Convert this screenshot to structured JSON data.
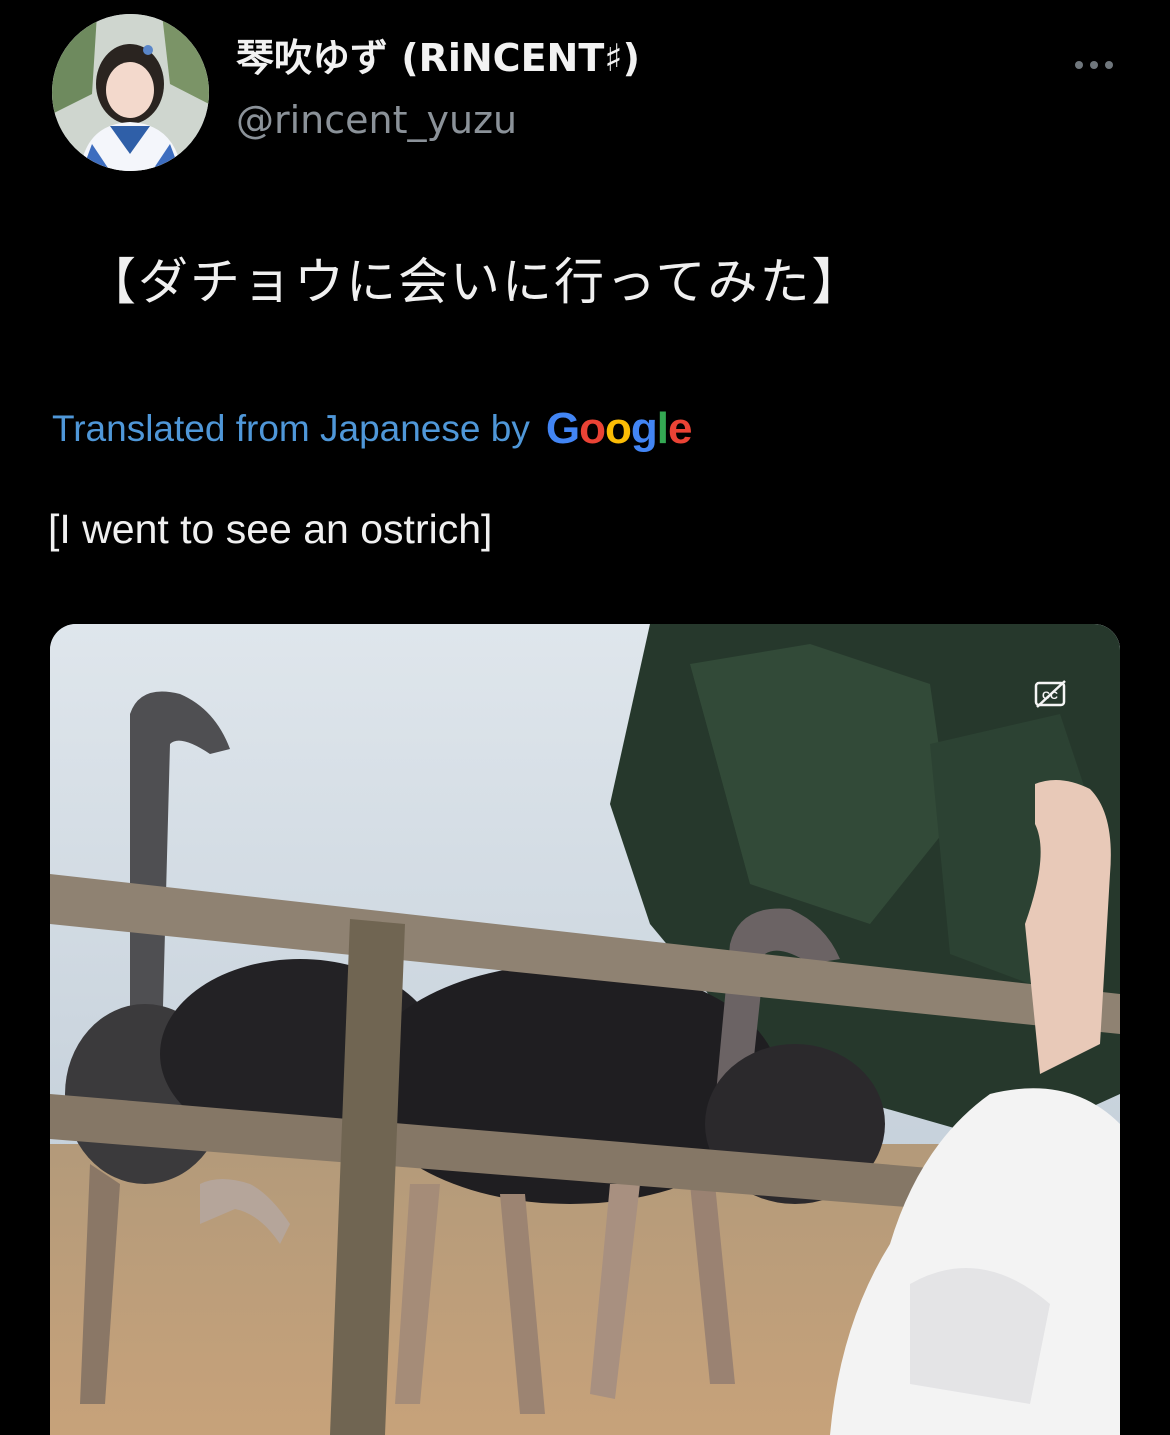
{
  "tweet": {
    "author": {
      "display_name": "琴吹ゆず (RiNCENT♯)",
      "handle": "@rincent_yuzu",
      "avatar_icon": "user-avatar"
    },
    "more_icon": "more-horizontal-icon",
    "text": "【ダチョウに会いに行ってみた】",
    "translation": {
      "label": "Translated from Japanese by",
      "provider": [
        "G",
        "o",
        "o",
        "g",
        "l",
        "e"
      ],
      "text": "[I went to see an ostrich]"
    },
    "media": {
      "type": "video",
      "captions_icon": "captions-off-icon"
    }
  },
  "colors": {
    "background": "#000000",
    "link_blue": "#4f97d8",
    "secondary_text": "#8b9299",
    "google_blue": "#4285f4",
    "google_red": "#ea4335",
    "google_yellow": "#fbbc05",
    "google_green": "#34a853"
  }
}
